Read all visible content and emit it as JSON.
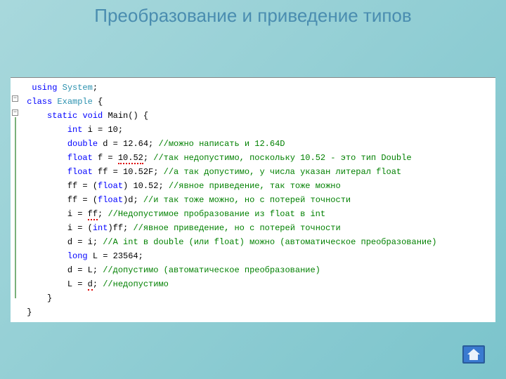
{
  "title": "Преобразование и приведение типов",
  "code": {
    "l1_kw1": "using",
    "l1_type": "System",
    "l1_end": ";",
    "l2_kw1": "class",
    "l2_type": "Example",
    "l2_end": " {",
    "l3_kw1": "static",
    "l3_kw2": "void",
    "l3_name": "Main",
    "l3_end": "() {",
    "l4_kw": "int",
    "l4_rest": " i = 10;",
    "l5_kw": "double",
    "l5_rest": " d = 12.64; ",
    "l5_cm": "//можно написать и 12.64D",
    "l6_kw": "float",
    "l6_a": " f = ",
    "l6_sq": "10.52",
    "l6_b": "; ",
    "l6_cm": "//так недопустимо, поскольку 10.52 - это тип Double",
    "l7_kw": "float",
    "l7_rest": " ff = 10.52F; ",
    "l7_cm": "//а так допустимо, у числа указан литерал float",
    "l8_a": "ff = (",
    "l8_kw": "float",
    "l8_b": ") 10.52; ",
    "l8_cm": "//явное приведение, так тоже можно",
    "l9_a": "ff = (",
    "l9_kw": "float",
    "l9_b": ")d; ",
    "l9_cm": "//и так тоже можно, но с потерей точности",
    "l10_a": "i = ",
    "l10_sq": "ff",
    "l10_b": "; ",
    "l10_cm": "//Недопустимое пробразование из float в int",
    "l11_a": "i = (",
    "l11_kw": "int",
    "l11_b": ")ff; ",
    "l11_cm": "//явное приведение, но с потерей точности",
    "l12_a": "d = i; ",
    "l12_cm": "//А int в double (или float) можно (автоматическое преобразование)",
    "l13_kw": "long",
    "l13_rest": " L = 23564;",
    "l14_a": "d = L; ",
    "l14_cm": "//допустимо (автоматическое преобразование)",
    "l15_a": "L = ",
    "l15_sq": "d",
    "l15_b": "; ",
    "l15_cm": "//недопустимо",
    "l16": "}",
    "l17": "}"
  },
  "fold_marks": {
    "mark1": "−",
    "mark2": "−"
  }
}
